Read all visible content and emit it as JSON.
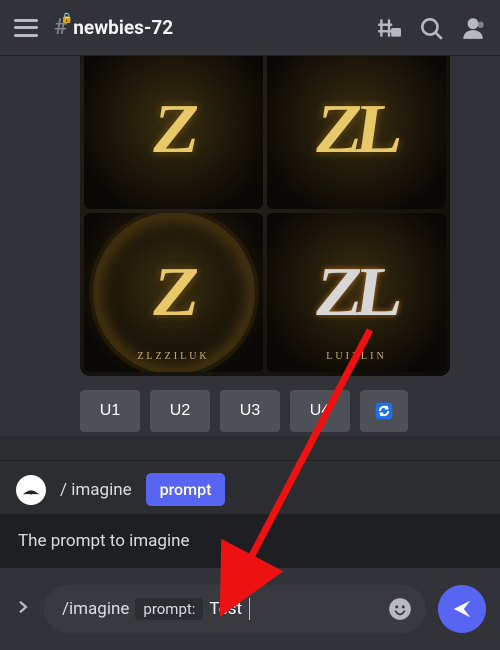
{
  "header": {
    "channel_name": "newbies-72"
  },
  "image_tiles": {
    "t1_glyph": "Z",
    "t2_glyph": "ZL",
    "t3_glyph": "Z",
    "t3_caption": "ZLZZILUK",
    "t4_glyph": "ZL",
    "t4_caption": "LUIZLIN"
  },
  "buttons": {
    "u1": "U1",
    "u2": "U2",
    "u3": "U3",
    "u4": "U4"
  },
  "command_helper": {
    "command": "/ imagine",
    "chip": "prompt"
  },
  "hint": "The prompt to imagine",
  "input": {
    "slash_cmd": "/imagine",
    "param_label": "prompt:",
    "typed_text": "Test"
  }
}
